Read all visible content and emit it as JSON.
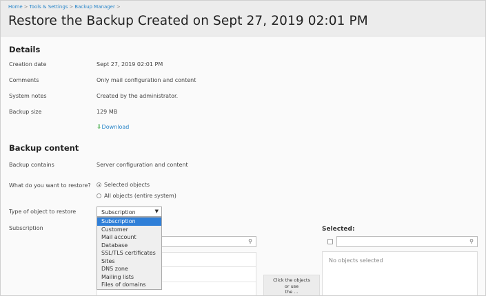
{
  "breadcrumb": [
    "Home",
    "Tools & Settings",
    "Backup Manager"
  ],
  "breadcrumb_sep": ">",
  "title": "Restore the Backup Created on Sept 27, 2019 02:01 PM",
  "details": {
    "heading": "Details",
    "rows": [
      {
        "label": "Creation date",
        "value": "Sept 27, 2019 02:01 PM"
      },
      {
        "label": "Comments",
        "value": "Only mail configuration and content"
      },
      {
        "label": "System notes",
        "value": "Created by the administrator."
      },
      {
        "label": "Backup size",
        "value": "129 MB"
      }
    ],
    "download_label": "Download",
    "download_icon": "download-arrow-icon"
  },
  "backup_content": {
    "heading": "Backup content",
    "contains_label": "Backup contains",
    "contains_value": "Server configuration and content",
    "restore_label": "What do you want to restore?",
    "options": [
      "Selected objects",
      "All objects (entire system)"
    ],
    "selected_option": "Selected objects",
    "type_label": "Type of object to restore",
    "type_value": "Subscription",
    "type_options": [
      "Subscription",
      "Customer",
      "Mail account",
      "Database",
      "SSL/TLS certificates",
      "Sites",
      "DNS zone",
      "Mailing lists",
      "Files of domains"
    ],
    "subscription_label": "Subscription",
    "selected_heading": "Selected:",
    "no_objects": "No objects selected",
    "hint_lines": [
      "Click the objects",
      "or use",
      "the ..."
    ]
  },
  "colors": {
    "accent": "#2a86c9",
    "selected_option": "#2f7fd8",
    "download_icon": "#4caf50"
  }
}
